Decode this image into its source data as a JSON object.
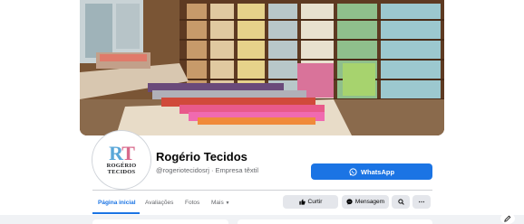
{
  "page": {
    "name": "Rogério Tecidos",
    "handle_category": "@rogeriotecidosrj · Empresa têxtil"
  },
  "avatar": {
    "monogram_r": "R",
    "monogram_t": "T",
    "line1": "ROGÉRIO",
    "line2": "TECIDOS"
  },
  "cta": {
    "whatsapp_label": "WhatsApp",
    "icon": "whatsapp-icon"
  },
  "tabs": [
    {
      "label": "Página inicial",
      "active": true
    },
    {
      "label": "Avaliações",
      "active": false
    },
    {
      "label": "Fotos",
      "active": false
    },
    {
      "label": "Mais",
      "active": false
    }
  ],
  "actions": {
    "like_label": "Curtir",
    "message_label": "Mensagem"
  },
  "colors": {
    "accent": "#1b74e4",
    "button_gray": "#e4e6eb",
    "text_secondary": "#65676b"
  }
}
